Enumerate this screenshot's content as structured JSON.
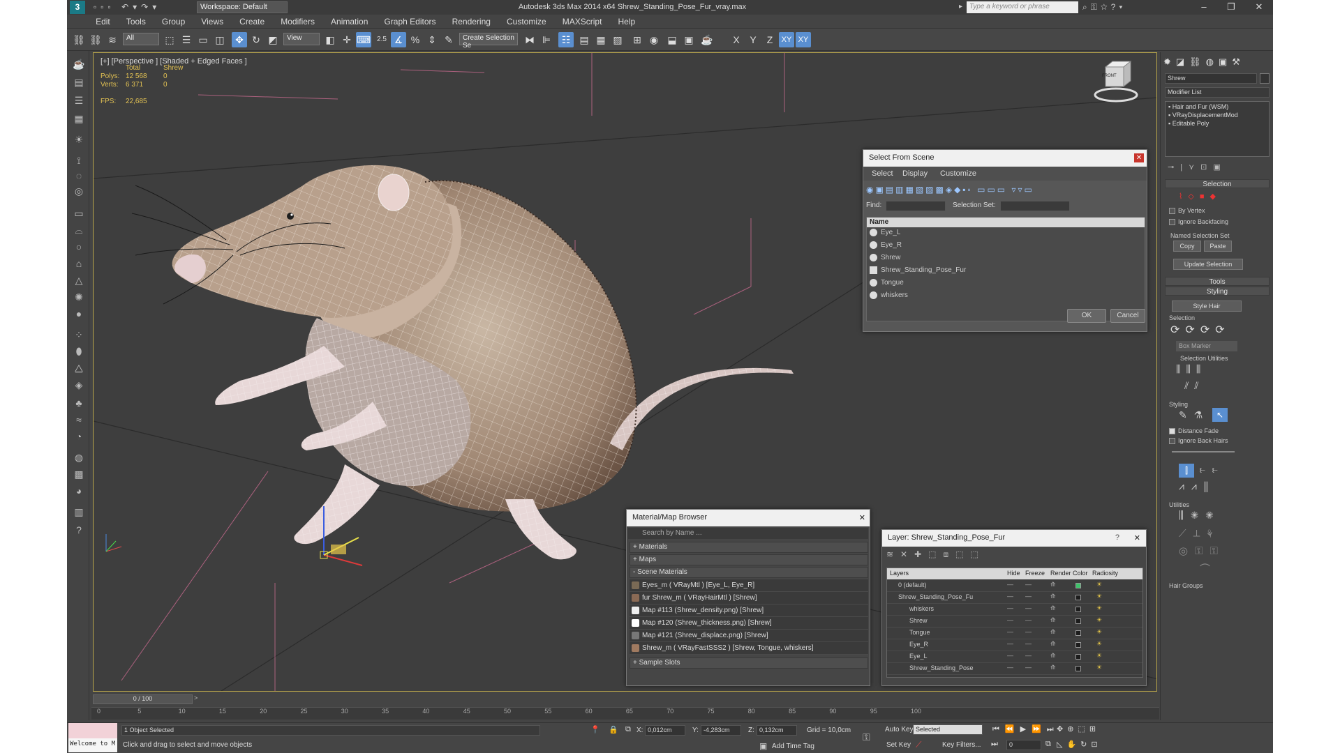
{
  "title_bar": {
    "workspace": "Workspace: Default",
    "title": "Autodesk 3ds Max  2014 x64     Shrew_Standing_Pose_Fur_vray.max",
    "search_placeholder": "Type a keyword or phrase"
  },
  "menu": [
    "Edit",
    "Tools",
    "Group",
    "Views",
    "Create",
    "Modifiers",
    "Animation",
    "Graph Editors",
    "Rendering",
    "Customize",
    "MAXScript",
    "Help"
  ],
  "toolbar": {
    "filter": "All",
    "view": "View",
    "snap_value": "2.5",
    "selection_set": "Create Selection Se",
    "axes": [
      "X",
      "Y",
      "Z",
      "XY",
      "XY"
    ]
  },
  "viewport": {
    "label": "[+] [Perspective ] [Shaded + Edged Faces ]",
    "stats_header": [
      "Total",
      "Shrew"
    ],
    "polys_label": "Polys:",
    "polys": [
      "12 568",
      "0"
    ],
    "verts_label": "Verts:",
    "verts": [
      "6 371",
      "0"
    ],
    "fps_label": "FPS:",
    "fps": "22,685",
    "viewcube": "FRONT"
  },
  "select_from_scene": {
    "title": "Select From Scene",
    "menu": [
      "Select",
      "Display",
      "Customize"
    ],
    "find_label": "Find:",
    "selection_set_label": "Selection Set:",
    "column": "Name",
    "items": [
      "Eye_L",
      "Eye_R",
      "Shrew",
      "Shrew_Standing_Pose_Fur",
      "Tongue",
      "whiskers"
    ],
    "ok": "OK",
    "cancel": "Cancel"
  },
  "material_browser": {
    "title": "Material/Map Browser",
    "search_placeholder": "Search by Name ...",
    "sections": [
      "+ Materials",
      "+ Maps",
      "- Scene Materials"
    ],
    "items": [
      {
        "label": "Eyes_m  ( VRayMtl ) [Eye_L, Eye_R]",
        "color": "#7a6a55"
      },
      {
        "label": "fur Shrew_m  ( VRayHairMtl ) [Shrew]",
        "color": "#8a6a55"
      },
      {
        "label": "Map #113 (Shrew_density.png)  [Shrew]",
        "color": "#eeeeee"
      },
      {
        "label": "Map #120 (Shrew_thickness.png)  [Shrew]",
        "color": "#ffffff"
      },
      {
        "label": "Map #121 (Shrew_displace.png)  [Shrew]",
        "color": "#777777"
      },
      {
        "label": "Shrew_m  ( VRayFastSSS2 ) [Shrew, Tongue, whiskers]",
        "color": "#a07a60"
      }
    ],
    "footer": "+ Sample Slots"
  },
  "layer_dialog": {
    "title": "Layer: Shrew_Standing_Pose_Fur",
    "help": "?",
    "columns": [
      "Layers",
      "Hide",
      "Freeze",
      "Render",
      "Color",
      "Radiosity"
    ],
    "rows": [
      {
        "name": "0 (default)",
        "indent": 0,
        "color": "#3ec26a"
      },
      {
        "name": "Shrew_Standing_Pose_Fu",
        "indent": 0,
        "color": "#1c1c1c"
      },
      {
        "name": "whiskers",
        "indent": 1,
        "color": "#1c1c1c"
      },
      {
        "name": "Shrew",
        "indent": 1,
        "color": "#1c1c1c"
      },
      {
        "name": "Tongue",
        "indent": 1,
        "color": "#1c1c1c"
      },
      {
        "name": "Eye_R",
        "indent": 1,
        "color": "#1c1c1c"
      },
      {
        "name": "Eye_L",
        "indent": 1,
        "color": "#1c1c1c"
      },
      {
        "name": "Shrew_Standing_Pose",
        "indent": 1,
        "color": "#1c1c1c"
      }
    ]
  },
  "command_panel": {
    "object_name": "Shrew",
    "modifier_list": "Modifier List",
    "stack": [
      "Hair and Fur (WSM)",
      "VRayDisplacementMod",
      "Editable Poly"
    ],
    "selection_rollout": "Selection",
    "by_vertex": "By Vertex",
    "ignore_backfacing": "Ignore Backfacing",
    "named_selection_sets": "Named Selection Set",
    "copy": "Copy",
    "paste": "Paste",
    "update_selection": "Update Selection",
    "tools_rollout": "Tools",
    "styling_rollout": "Styling",
    "style_hair": "Style Hair",
    "selection_group": "Selection",
    "box_marker": "Box Marker",
    "selection_utilities": "Selection Utilities",
    "styling_group": "Styling",
    "distance_fade": "Distance Fade",
    "ignore_back_hairs": "Ignore Back Hairs",
    "utilities_group": "Utilities",
    "hair_groups": "Hair Groups"
  },
  "timeline": {
    "frame": "0 / 100",
    "ticks": [
      "0",
      "5",
      "10",
      "15",
      "20",
      "25",
      "30",
      "35",
      "40",
      "45",
      "50",
      "55",
      "60",
      "65",
      "70",
      "75",
      "80",
      "85",
      "90",
      "95",
      "100"
    ]
  },
  "status_bar": {
    "maxscript": "Welcome to M",
    "selected": "1 Object Selected",
    "hint": "Click and drag to select and move objects",
    "x_label": "X:",
    "x": "0,012cm",
    "y_label": "Y:",
    "y": "-4,283cm",
    "z_label": "Z:",
    "z": "0,132cm",
    "grid": "Grid = 10,0cm",
    "auto_key": "Auto Key",
    "auto_key_value": "Selected",
    "set_key": "Set Key",
    "key_filters": "Key Filters...",
    "add_time_tag": "Add Time Tag",
    "current_frame": "0"
  }
}
